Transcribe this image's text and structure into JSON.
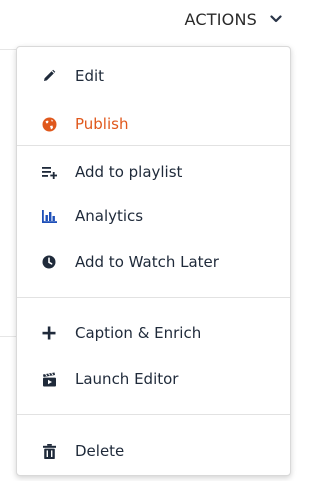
{
  "header": {
    "actions_label": "ACTIONS"
  },
  "colors": {
    "publish_accent": "#e0581c",
    "text": "#1f2a3a",
    "border": "#d9d9d9"
  },
  "menu": {
    "items": [
      {
        "label": "Edit",
        "icon": "pencil-icon"
      },
      {
        "label": "Publish",
        "icon": "globe-icon"
      },
      {
        "label": "Add to playlist",
        "icon": "playlist-add-icon"
      },
      {
        "label": "Analytics",
        "icon": "bar-chart-icon"
      },
      {
        "label": "Add to Watch Later",
        "icon": "clock-icon"
      },
      {
        "label": "Caption & Enrich",
        "icon": "plus-icon"
      },
      {
        "label": "Launch Editor",
        "icon": "clapperboard-icon"
      },
      {
        "label": "Delete",
        "icon": "trash-icon"
      }
    ]
  }
}
